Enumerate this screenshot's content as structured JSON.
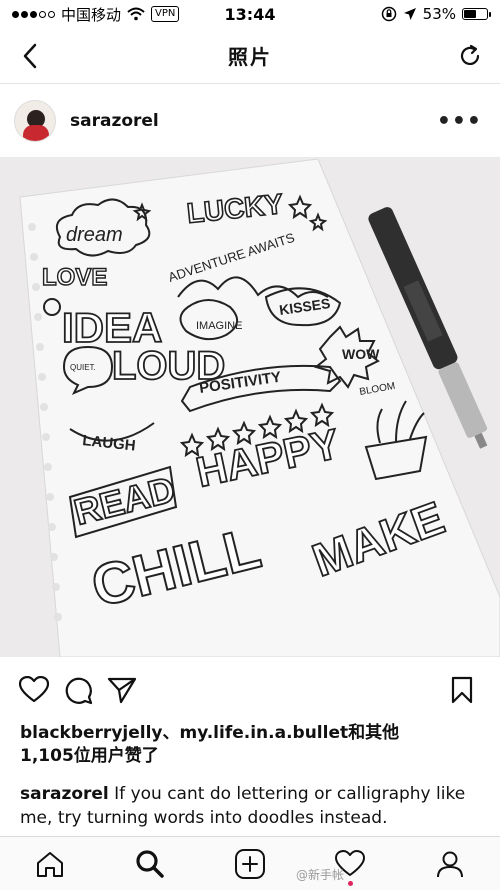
{
  "status_bar": {
    "carrier": "中国移动",
    "vpn": "VPN",
    "time": "13:44",
    "battery": "53%",
    "battery_level": 0.53
  },
  "nav": {
    "title": "照片",
    "back_icon": "chevron-left-icon",
    "refresh_icon": "refresh-icon"
  },
  "post": {
    "username": "sarazorel",
    "more": "•••"
  },
  "photo": {
    "doodles": {
      "dream": "dream",
      "lucky": "LUCKY",
      "love": "LOVE",
      "adventure": "ADVENTURE AWAITS",
      "idea": "IDEA",
      "imagine": "IMAGINE",
      "kisses": "KISSES",
      "quiet": "QUIET.",
      "loud": "LOUD",
      "positivity": "POSITIVITY",
      "wow": "WOW",
      "laugh": "LAUGH",
      "read": "READ",
      "happy": "HAPPY",
      "bloom": "BLOOM",
      "chill": "CHILL",
      "make": "MAKE"
    }
  },
  "actions": {
    "like_icon": "heart-icon",
    "comment_icon": "comment-icon",
    "share_icon": "send-icon",
    "save_icon": "bookmark-icon"
  },
  "likes": {
    "names": "blackberryjelly、my.life.in.a.bullet和其他",
    "count": "1,105位用户赞了"
  },
  "caption": {
    "user": "sarazorel",
    "text": " If you cant do lettering or calligraphy like me, try turning words into doodles instead."
  },
  "tabs": [
    {
      "icon": "home-icon"
    },
    {
      "icon": "search-icon"
    },
    {
      "icon": "add-post-icon"
    },
    {
      "icon": "activity-heart-icon"
    },
    {
      "icon": "profile-icon"
    }
  ],
  "watermark": "@新手帐"
}
